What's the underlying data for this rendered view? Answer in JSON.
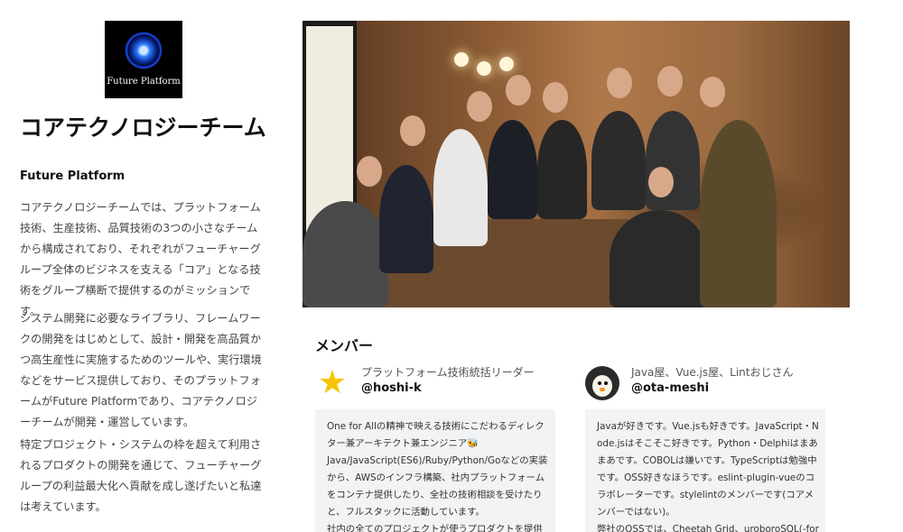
{
  "logo": {
    "text": "Future Platform"
  },
  "team": {
    "title": "コアテクノロジーチーム",
    "section_title": "Future Platform",
    "paragraphs": [
      "コアテクノロジーチームでは、プラットフォーム技術、生産技術、品質技術の3つの小さなチームから構成されており、それぞれがフューチャーグループ全体のビジネスを支える「コア」となる技術をグループ横断で提供するのがミッションです。",
      "システム開発に必要なライブラリ、フレームワークの開発をはじめとして、設計・開発を高品質かつ高生産性に実施するためのツールや、実行環境などをサービス提供しており、そのプラットフォームがFuture Platformであり、コアテクノロジーチームが開発・運営しています。",
      "特定プロジェクト・システムの枠を超えて利用されるプロダクトの開発を通じて、フューチャーグループの利益最大化へ貢献を成し遂げたいと私達は考えています。"
    ]
  },
  "photo": {
    "icon": "team-photo"
  },
  "members": {
    "title": "メンバー",
    "list": [
      {
        "role": "プラットフォーム技術統括リーダー",
        "handle": "@hoshi-k",
        "avatar_icon": "star-icon",
        "bio_lines": [
          "One for Allの精神で映える技術にこだわるディレクター兼アーキテクト兼エンジニア🐝",
          "Java/JavaScript(ES6)/Ruby/Python/Goなどの実装から、AWSのインフラ構築、社内プラットフォームをコンテナ提供したり、全社の技術相談を受けたりと、フルスタックに活動しています。",
          "社内の全てのプロジェクトが使うプロダクトを提供す"
        ]
      },
      {
        "role": "Java屋、Vue.js屋、Lintおじさん",
        "handle": "@ota-meshi",
        "avatar_icon": "penguin-icon",
        "bio_lines": [
          "Javaが好きです。Vue.jsも好きです。JavaScript・Node.jsはそこそこ好きです。Python・Delphiはまあまあです。COBOLは嫌いです。TypeScriptは勉強中です。OSS好きなほうです。eslint-plugin-vueのコラボレーターです。stylelintのメンバーです(コアメンバーではない)。",
          "弊社のOSSでは、Cheetah Grid、uroboroSQL(-formatt"
        ]
      }
    ]
  },
  "colors": {
    "bio_background": "#f1f3f5",
    "logo_background": "#000000",
    "accent_star": "#f6c400"
  }
}
